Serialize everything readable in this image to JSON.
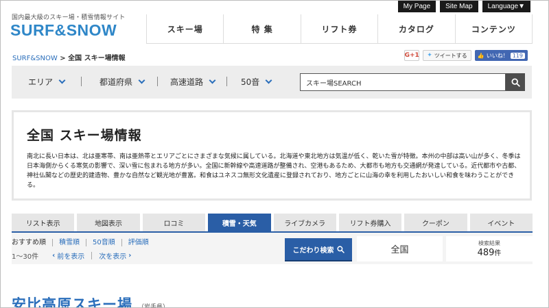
{
  "top_links": [
    "My Page",
    "Site Map",
    "Language▼"
  ],
  "brand": {
    "tagline": "国内最大級のスキー場・積雪情報サイト",
    "logo": "SURF&SNOW"
  },
  "gnav": [
    "スキー場",
    "特 集",
    "リフト券",
    "カタログ",
    "コンテンツ"
  ],
  "breadcrumb": {
    "home": "SURF&SNOW",
    "sep": " > ",
    "current": "全国 スキー場情報"
  },
  "social": {
    "gplus": "G+1",
    "tweet": "ツイートする",
    "like": "いいね！",
    "like_count": "119"
  },
  "filters": [
    "エリア",
    "都道府県",
    "高速道路",
    "50音"
  ],
  "search": {
    "placeholder": "スキー場SEARCH"
  },
  "info": {
    "title": "全国 スキー場情報",
    "body": "南北に長い日本は、北は亜寒帯、南は亜熱帯とエリアごとにさまざまな気候に属している。北海道や東北地方は気温が低く、乾いた雪が特徴。本州の中部は高い山が多く、冬季は日本海側からくる寒気の影響で、深い雪に包まれる地方が多い。全国に新幹線や高速道路が整備され、空港もあるため、大都市も地方も交通網が発達している。近代都市や古都、神社仏閣などの歴史的建造物、豊かな自然など観光地が豊富。和食はユネスコ無形文化遺産に登録されており、地方ごとに山海の幸を利用したおいしい和食を味わうことができる。"
  },
  "tabs": [
    {
      "label": "リスト表示",
      "active": false
    },
    {
      "label": "地図表示",
      "active": false
    },
    {
      "label": "ロコミ",
      "active": false
    },
    {
      "label": "積雪・天気",
      "active": true
    },
    {
      "label": "ライブカメラ",
      "active": false
    },
    {
      "label": "リフト券購入",
      "active": false
    },
    {
      "label": "クーポン",
      "active": false
    },
    {
      "label": "イベント",
      "active": false
    }
  ],
  "sort": {
    "current": "おすすめ順",
    "options": [
      "積雪順",
      "50音順",
      "評価順"
    ]
  },
  "pager": {
    "range": "1〜30件",
    "prev": "前を表示",
    "next": "次を表示"
  },
  "kodawari": "こだわり検索",
  "region": "全国",
  "results": {
    "label": "検索結果",
    "count": "489",
    "unit": "件"
  },
  "first_result": {
    "title": "安比高原スキー場",
    "sub": "（岩手県）"
  },
  "colors": {
    "brand_blue": "#2f87c8",
    "accent_blue": "#2a5ea6",
    "link": "#2a6ebb",
    "facebook": "#4267b2"
  }
}
